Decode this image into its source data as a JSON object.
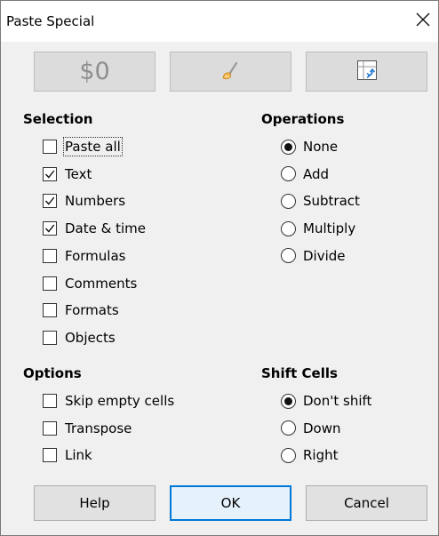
{
  "window": {
    "title": "Paste Special",
    "close_glyph": "×"
  },
  "presets": {
    "values_only_label": "$0",
    "formats_only_icon": "brush-icon",
    "transpose_icon": "transpose-icon"
  },
  "selection": {
    "title": "Selection",
    "items": [
      {
        "label": "Paste all",
        "checked": false,
        "focused": true
      },
      {
        "label": "Text",
        "checked": true
      },
      {
        "label": "Numbers",
        "checked": true
      },
      {
        "label": "Date & time",
        "checked": true
      },
      {
        "label": "Formulas",
        "checked": false
      },
      {
        "label": "Comments",
        "checked": false
      },
      {
        "label": "Formats",
        "checked": false
      },
      {
        "label": "Objects",
        "checked": false
      }
    ]
  },
  "operations": {
    "title": "Operations",
    "items": [
      {
        "label": "None",
        "selected": true
      },
      {
        "label": "Add",
        "selected": false
      },
      {
        "label": "Subtract",
        "selected": false
      },
      {
        "label": "Multiply",
        "selected": false
      },
      {
        "label": "Divide",
        "selected": false
      }
    ]
  },
  "options": {
    "title": "Options",
    "items": [
      {
        "label": "Skip empty cells",
        "checked": false
      },
      {
        "label": "Transpose",
        "checked": false
      },
      {
        "label": "Link",
        "checked": false
      }
    ]
  },
  "shift_cells": {
    "title": "Shift Cells",
    "items": [
      {
        "label": "Don't shift",
        "selected": true
      },
      {
        "label": "Down",
        "selected": false
      },
      {
        "label": "Right",
        "selected": false
      }
    ]
  },
  "buttons": {
    "help": "Help",
    "ok": "OK",
    "cancel": "Cancel"
  }
}
